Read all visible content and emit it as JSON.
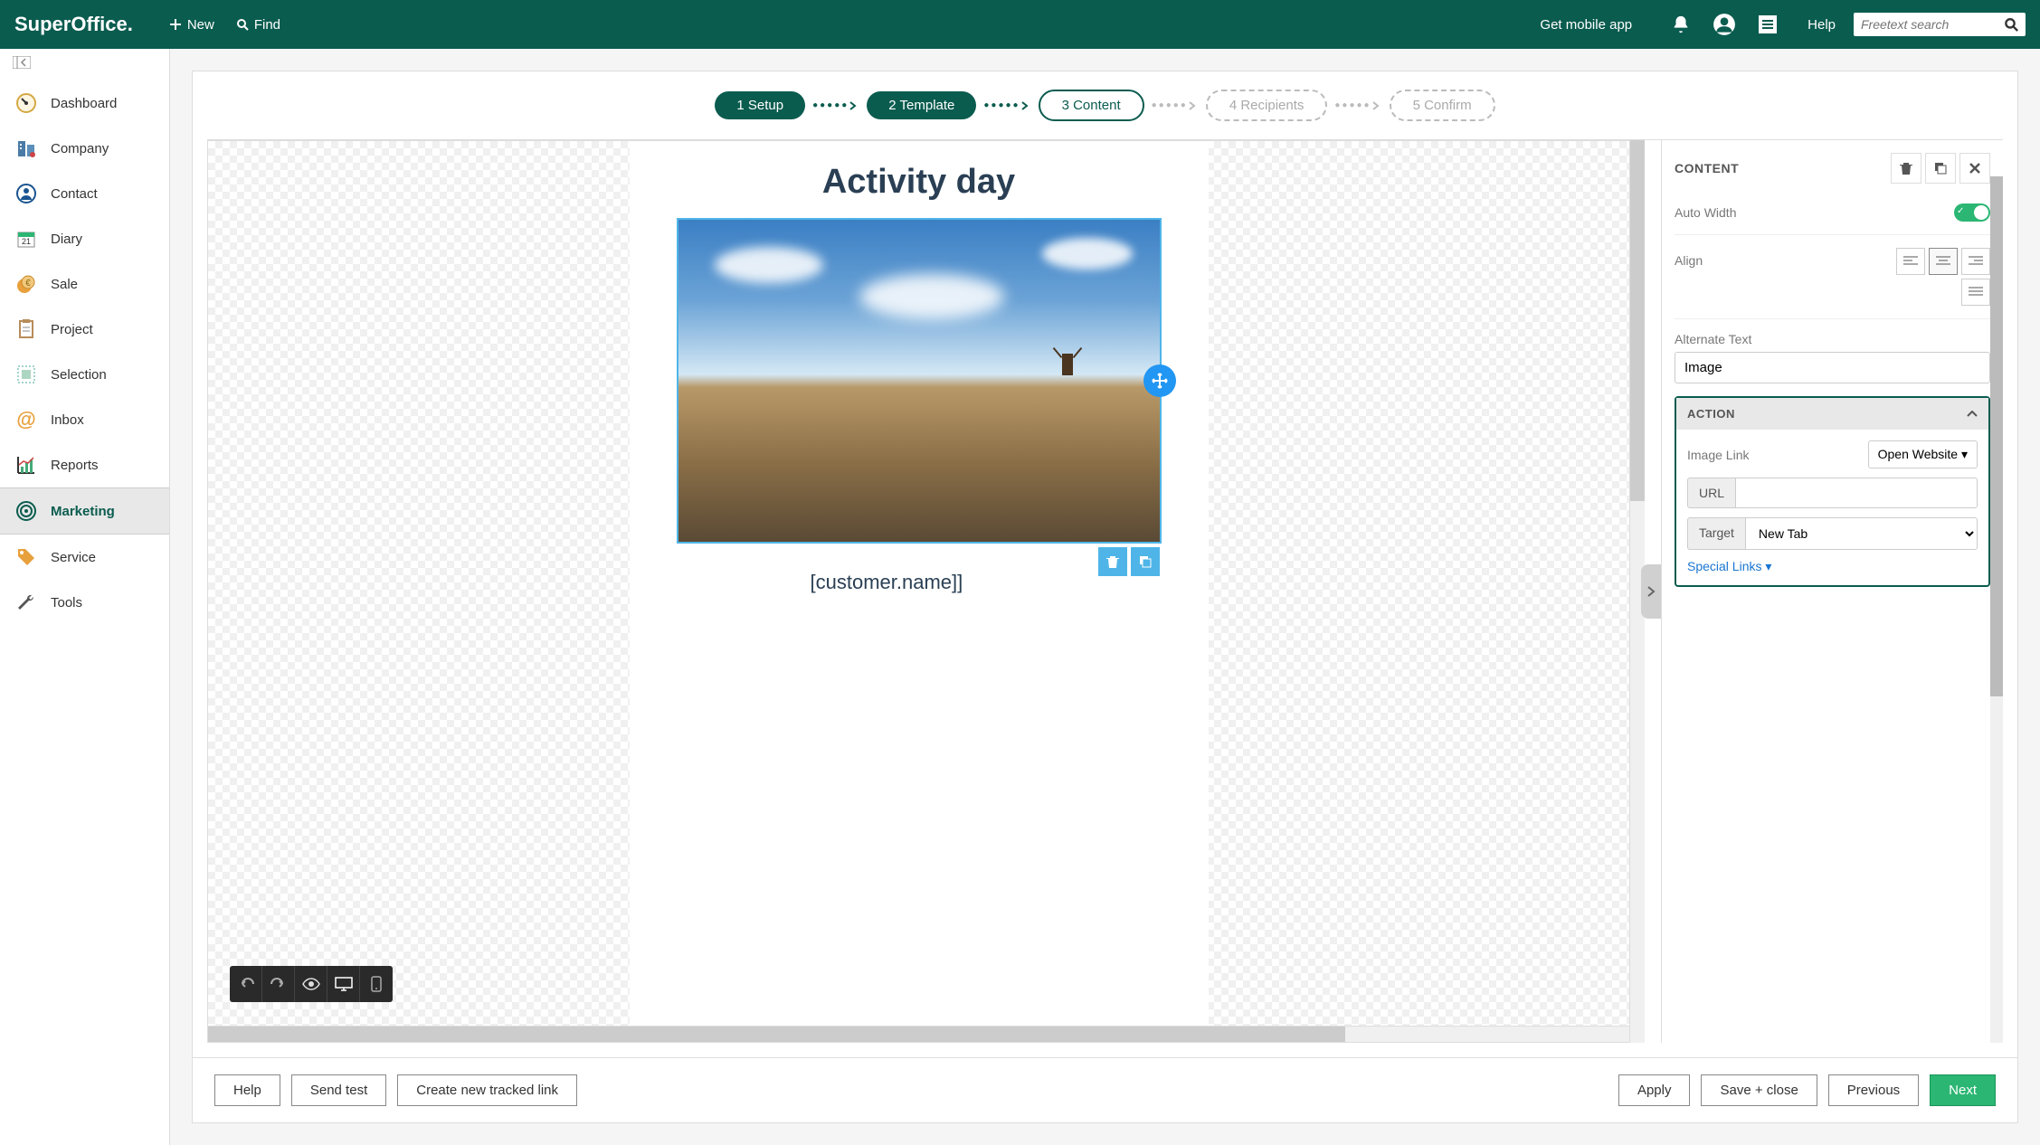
{
  "header": {
    "logo": "SuperOffice.",
    "new_label": "New",
    "find_label": "Find",
    "mobile_label": "Get mobile app",
    "help_label": "Help",
    "search_placeholder": "Freetext search"
  },
  "sidebar": {
    "items": [
      {
        "label": "Dashboard"
      },
      {
        "label": "Company"
      },
      {
        "label": "Contact"
      },
      {
        "label": "Diary"
      },
      {
        "label": "Sale"
      },
      {
        "label": "Project"
      },
      {
        "label": "Selection"
      },
      {
        "label": "Inbox"
      },
      {
        "label": "Reports"
      },
      {
        "label": "Marketing"
      },
      {
        "label": "Service"
      },
      {
        "label": "Tools"
      }
    ]
  },
  "stepper": {
    "steps": [
      {
        "label": "1 Setup"
      },
      {
        "label": "2 Template"
      },
      {
        "label": "3 Content"
      },
      {
        "label": "4 Recipients"
      },
      {
        "label": "5 Confirm"
      }
    ]
  },
  "email": {
    "title": "Activity day",
    "greeting": "[customer.name]]"
  },
  "props": {
    "title": "CONTENT",
    "auto_width_label": "Auto Width",
    "align_label": "Align",
    "alt_text_label": "Alternate Text",
    "alt_text_value": "Image",
    "action_title": "ACTION",
    "image_link_label": "Image Link",
    "open_website_label": "Open Website",
    "url_label": "URL",
    "url_value": "",
    "target_label": "Target",
    "target_value": "New Tab",
    "special_links_label": "Special Links"
  },
  "footer": {
    "help": "Help",
    "send_test": "Send test",
    "create_link": "Create new tracked link",
    "apply": "Apply",
    "save_close": "Save + close",
    "previous": "Previous",
    "next": "Next"
  }
}
